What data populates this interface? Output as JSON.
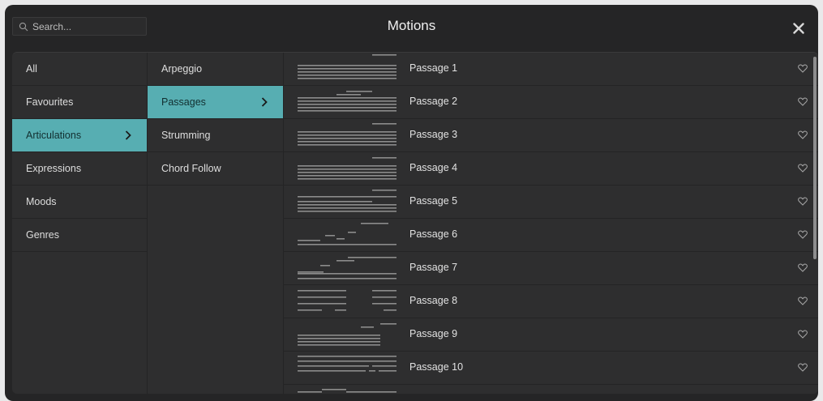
{
  "search": {
    "placeholder": "Search...",
    "value": ""
  },
  "header": {
    "title": "Motions"
  },
  "categories": [
    {
      "label": "All",
      "selected": false
    },
    {
      "label": "Favourites",
      "selected": false
    },
    {
      "label": "Articulations",
      "selected": true
    },
    {
      "label": "Expressions",
      "selected": false
    },
    {
      "label": "Moods",
      "selected": false
    },
    {
      "label": "Genres",
      "selected": false
    }
  ],
  "subcategories": [
    {
      "label": "Arpeggio",
      "selected": false
    },
    {
      "label": "Passages",
      "selected": true
    },
    {
      "label": "Strumming",
      "selected": false
    },
    {
      "label": "Chord Follow",
      "selected": false
    }
  ],
  "motions": [
    {
      "label": "Passage 1",
      "favourite": false
    },
    {
      "label": "Passage 2",
      "favourite": false
    },
    {
      "label": "Passage 3",
      "favourite": false
    },
    {
      "label": "Passage 4",
      "favourite": false
    },
    {
      "label": "Passage 5",
      "favourite": false
    },
    {
      "label": "Passage 6",
      "favourite": false
    },
    {
      "label": "Passage 7",
      "favourite": false
    },
    {
      "label": "Passage 8",
      "favourite": false
    },
    {
      "label": "Passage 9",
      "favourite": false
    },
    {
      "label": "Passage 10",
      "favourite": false
    }
  ],
  "colors": {
    "accent": "#57aeb2",
    "window_bg": "#252526",
    "panel_bg": "#2e2e2f",
    "divider": "#242425"
  }
}
